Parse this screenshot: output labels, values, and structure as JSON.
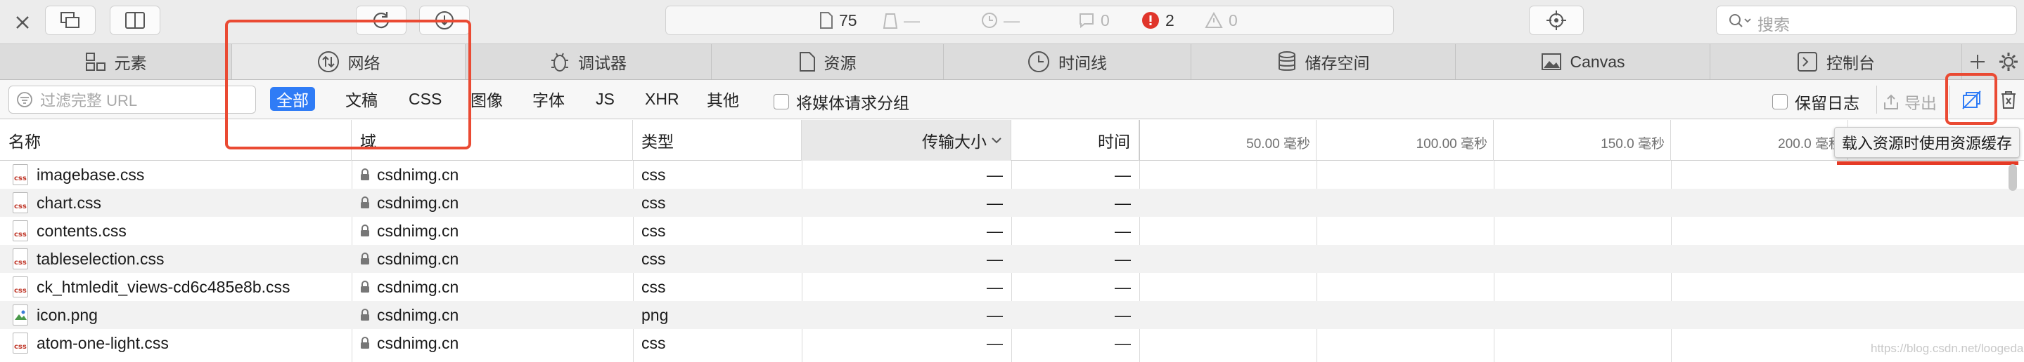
{
  "toolbar": {
    "resources_count": "75",
    "requests_count": "—",
    "time_count": "—",
    "logs_count": "0",
    "errors_count": "2",
    "warnings_count": "0",
    "search_placeholder": "搜索"
  },
  "tabs": [
    {
      "label": "元素",
      "icon": "elements-icon"
    },
    {
      "label": "网络",
      "icon": "network-icon"
    },
    {
      "label": "调试器",
      "icon": "debugger-icon"
    },
    {
      "label": "资源",
      "icon": "resources-icon"
    },
    {
      "label": "时间线",
      "icon": "timeline-icon"
    },
    {
      "label": "储存空间",
      "icon": "storage-icon"
    },
    {
      "label": "Canvas",
      "icon": "canvas-icon"
    },
    {
      "label": "控制台",
      "icon": "console-icon"
    }
  ],
  "filter": {
    "placeholder": "过滤完整 URL",
    "types": [
      "全部",
      "文稿",
      "CSS",
      "图像",
      "字体",
      "JS",
      "XHR",
      "其他"
    ],
    "group_media_label": "将媒体请求分组",
    "preserve_log_label": "保留日志",
    "export_label": "导出"
  },
  "table": {
    "headers": {
      "name": "名称",
      "domain": "域",
      "type": "类型",
      "transfer": "传输大小",
      "time": "时间"
    },
    "ticks": [
      "50.00 毫秒",
      "100.00 毫秒",
      "150.0 毫秒",
      "200.0 毫秒"
    ],
    "rows": [
      {
        "name": "imagebase.css",
        "domain": "csdnimg.cn",
        "type": "css",
        "transfer": "—",
        "time": "—",
        "icon": "css-file-icon"
      },
      {
        "name": "chart.css",
        "domain": "csdnimg.cn",
        "type": "css",
        "transfer": "—",
        "time": "—",
        "icon": "css-file-icon"
      },
      {
        "name": "contents.css",
        "domain": "csdnimg.cn",
        "type": "css",
        "transfer": "—",
        "time": "—",
        "icon": "css-file-icon"
      },
      {
        "name": "tableselection.css",
        "domain": "csdnimg.cn",
        "type": "css",
        "transfer": "—",
        "time": "—",
        "icon": "css-file-icon"
      },
      {
        "name": "ck_htmledit_views-cd6c485e8b.css",
        "domain": "csdnimg.cn",
        "type": "css",
        "transfer": "—",
        "time": "—",
        "icon": "css-file-icon"
      },
      {
        "name": "icon.png",
        "domain": "csdnimg.cn",
        "type": "png",
        "transfer": "—",
        "time": "—",
        "icon": "image-file-icon"
      },
      {
        "name": "atom-one-light.css",
        "domain": "csdnimg.cn",
        "type": "css",
        "transfer": "—",
        "time": "—",
        "icon": "css-file-icon"
      }
    ]
  },
  "tooltip": "载入资源时使用资源缓存",
  "watermark": "https://blog.csdn.net/loogedai",
  "colors": {
    "accent": "#2f7cf6",
    "highlight": "#ea4a33",
    "error": "#e0352b"
  }
}
